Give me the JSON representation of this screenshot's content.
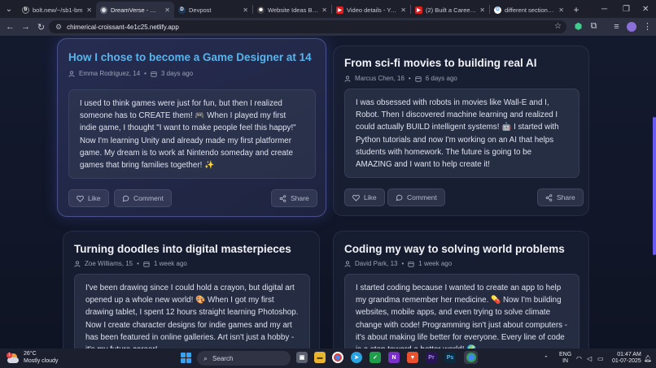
{
  "browser": {
    "tabs": [
      {
        "title": "bolt.new/~/sb1-bm",
        "favicon": "bolt-icon",
        "color": "#2a2d3a",
        "letter": "b",
        "active": false
      },
      {
        "title": "DreamVerse - Where",
        "favicon": "globe-icon",
        "color": "#6b7080",
        "letter": "",
        "active": true
      },
      {
        "title": "Devpost",
        "favicon": "devpost-icon",
        "color": "#1e3a5f",
        "letter": "D",
        "active": false
      },
      {
        "title": "Website Ideas Brains",
        "favicon": "openai-icon",
        "color": "#444",
        "letter": "",
        "active": false
      },
      {
        "title": "Video details - YouTu",
        "favicon": "youtube-icon",
        "color": "#e02020",
        "letter": "",
        "active": false
      },
      {
        "title": "(2) Built a Career Bu",
        "favicon": "youtube-icon",
        "color": "#e02020",
        "letter": "",
        "active": false
      },
      {
        "title": "different sections in",
        "favicon": "google-icon",
        "color": "#ffffff",
        "letter": "G",
        "active": false
      }
    ],
    "url": "chimerical-croissant-4e1c25.netlify.app"
  },
  "posts": [
    {
      "title": "How I chose to become a Game Designer at 14",
      "author": "Emma Rodriguez, 14",
      "time": "3 days ago",
      "story": "I used to think games were just for fun, but then I realized someone has to CREATE them! 🎮 When I played my first indie game, I thought \"I want to make people feel this happy!\" Now I'm learning Unity and already made my first platformer game. My dream is to work at Nintendo someday and create games that bring families together! ✨",
      "like": "Like",
      "comment": "Comment",
      "share": "Share",
      "featured": true
    },
    {
      "title": "From sci-fi movies to building real AI",
      "author": "Marcus Chen, 16",
      "time": "6 days ago",
      "story": "I was obsessed with robots in movies like Wall-E and I, Robot. Then I discovered machine learning and realized I could actually BUILD intelligent systems! 🤖 I started with Python tutorials and now I'm working on an AI that helps students with homework. The future is going to be AMAZING and I want to help create it!",
      "like": "Like",
      "comment": "Comment",
      "share": "Share",
      "featured": false
    },
    {
      "title": "Turning doodles into digital masterpieces",
      "author": "Zoe Williams, 15",
      "time": "1 week ago",
      "story": "I've been drawing since I could hold a crayon, but digital art opened up a whole new world! 🎨 When I got my first drawing tablet, I spent 12 hours straight learning Photoshop. Now I create character designs for indie games and my art has been featured in online galleries. Art isn't just a hobby - it's my future career!",
      "featured": false
    },
    {
      "title": "Coding my way to solving world problems",
      "author": "David Park, 13",
      "time": "1 week ago",
      "story": "I started coding because I wanted to create an app to help my grandma remember her medicine. 💊 Now I'm building websites, mobile apps, and even trying to solve climate change with code! Programming isn't just about computers - it's about making life better for everyone. Every line of code is a step toward a better world! 🌍",
      "featured": false
    }
  ],
  "taskbar": {
    "weather_temp": "26°C",
    "weather_desc": "Mostly cloudy",
    "weather_badge": "1",
    "search_placeholder": "Search",
    "lang_top": "ENG",
    "lang_bottom": "IN",
    "time": "01:47 AM",
    "date": "01-07-2025"
  }
}
